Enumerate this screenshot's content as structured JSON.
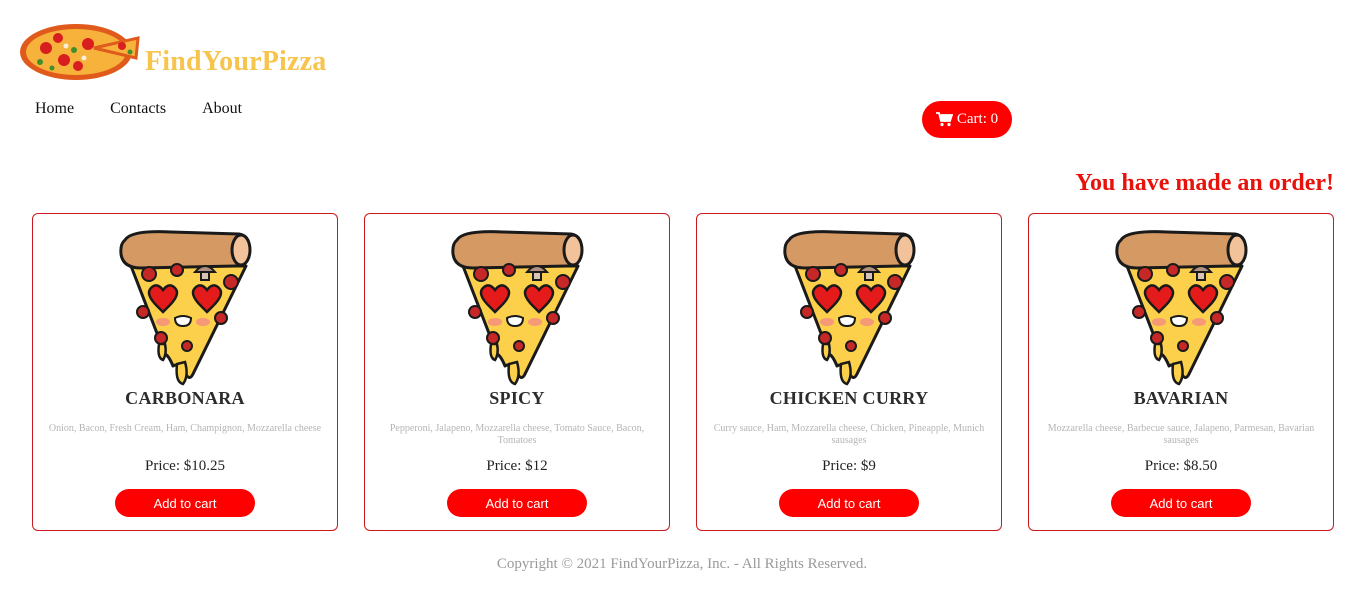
{
  "brand": {
    "name": "FindYourPizza"
  },
  "nav": {
    "items": [
      {
        "label": "Home"
      },
      {
        "label": "Contacts"
      },
      {
        "label": "About"
      }
    ]
  },
  "cart": {
    "label": "Cart: 0",
    "icon": "cart-icon"
  },
  "order_message": "You have made an order!",
  "products": [
    {
      "name": "CARBONARA",
      "ingredients": "Onion, Bacon, Fresh Cream, Ham, Champignon, Mozzarella cheese",
      "price": "Price: $10.25",
      "button": "Add to cart"
    },
    {
      "name": "SPICY",
      "ingredients": "Pepperoni, Jalapeno, Mozzarella cheese, Tomato Sauce, Bacon, Tomatoes",
      "price": "Price: $12",
      "button": "Add to cart"
    },
    {
      "name": "CHICKEN CURRY",
      "ingredients": "Curry sauce, Ham, Mozzarella cheese, Chicken, Pineapple, Munich sausages",
      "price": "Price: $9",
      "button": "Add to cart"
    },
    {
      "name": "BAVARIAN",
      "ingredients": "Mozzarella cheese, Barbecue sauce, Jalapeno, Parmesan, Bavarian sausages",
      "price": "Price: $8.50",
      "button": "Add to cart"
    }
  ],
  "footer": {
    "copyright": "Copyright © 2021 FindYourPizza, Inc. - All Rights Reserved."
  },
  "colors": {
    "accent": "#ff0000",
    "brand": "#f7c44d",
    "order": "#e8120c",
    "card_border": "#c9181e"
  }
}
